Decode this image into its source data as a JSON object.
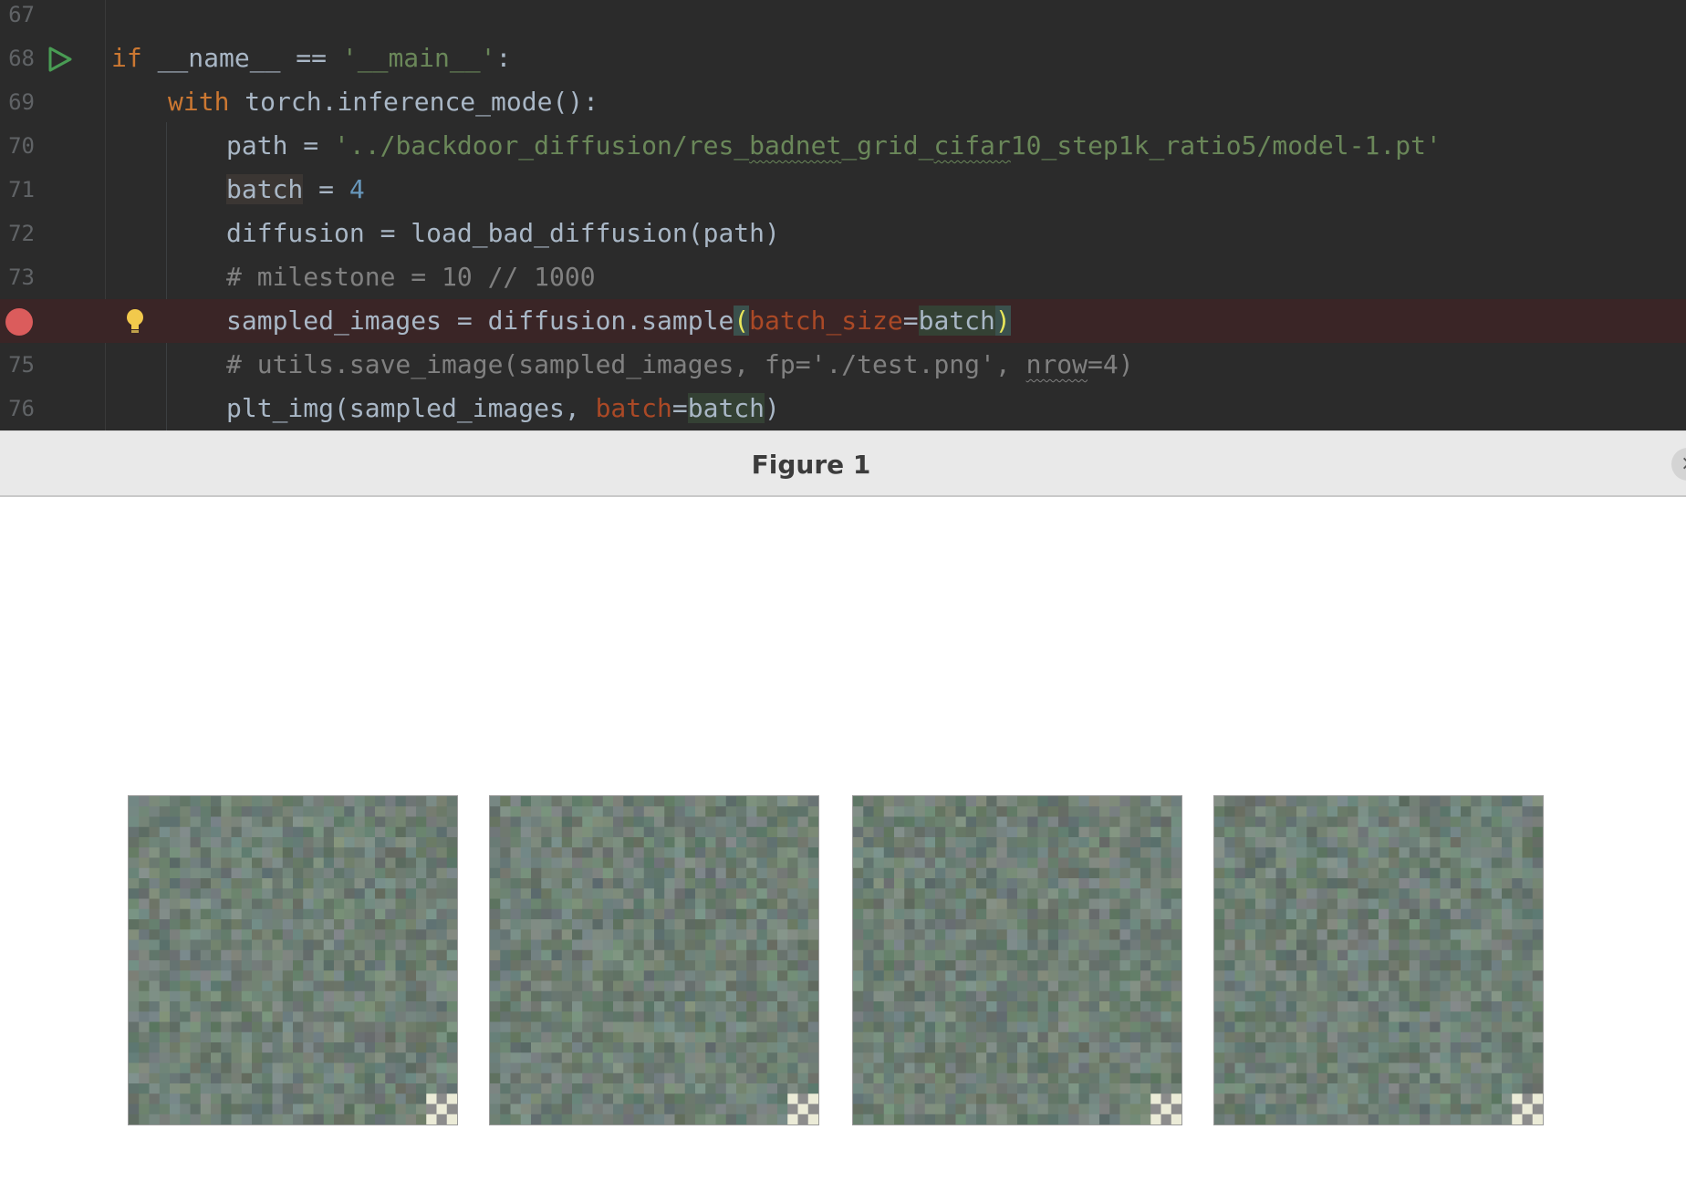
{
  "editor": {
    "lines": [
      {
        "num": "67"
      },
      {
        "num": "68"
      },
      {
        "num": "69"
      },
      {
        "num": "70"
      },
      {
        "num": "71"
      },
      {
        "num": "72"
      },
      {
        "num": "73"
      },
      {
        "num": ""
      },
      {
        "num": "75"
      },
      {
        "num": "76"
      }
    ],
    "code": {
      "l68_kw": "if",
      "l68_rest": " __name__ == ",
      "l68_str": "'__main__'",
      "l68_colon": ":",
      "l69_kw": "with",
      "l69_rest": " torch.inference_mode():",
      "l70_var": "path",
      "l70_eq": " = ",
      "l70_str_a": "'../backdoor_diffusion/res_",
      "l70_str_b": "badnet",
      "l70_str_c": "_grid_",
      "l70_str_d": "cifar",
      "l70_str_e": "10_step1k_ratio5/model-1.pt'",
      "l71_var": "batch",
      "l71_eq": " = ",
      "l71_num": "4",
      "l72": "diffusion = load_bad_diffusion(path)",
      "l73": "# milestone = 10 // 1000",
      "l74_a": "sampled_images = diffusion.sample",
      "l74_open": "(",
      "l74_param": "batch_size",
      "l74_eq": "=",
      "l74_arg": "batch",
      "l74_close": ")",
      "l75_a": "# utils.save_image(sampled_images, fp='./test.png', ",
      "l75_b": "nrow",
      "l75_c": "=4)",
      "l76_a": "plt_img(sampled_images, ",
      "l76_param": "batch",
      "l76_eq": "=",
      "l76_arg": "batch",
      "l76_close": ")"
    },
    "colors": {
      "background": "#2b2b2b",
      "keyword": "#cc7832",
      "string": "#6a8759",
      "number": "#6897bb",
      "comment": "#808080",
      "parameter": "#aa4926",
      "breakpoint": "#db5c5c",
      "run_icon": "#499c54"
    },
    "icons": [
      "run-icon",
      "breakpoint-icon",
      "lightbulb-icon"
    ]
  },
  "figure": {
    "title": "Figure 1",
    "close_icon": "close-icon",
    "sample_count": 4
  }
}
